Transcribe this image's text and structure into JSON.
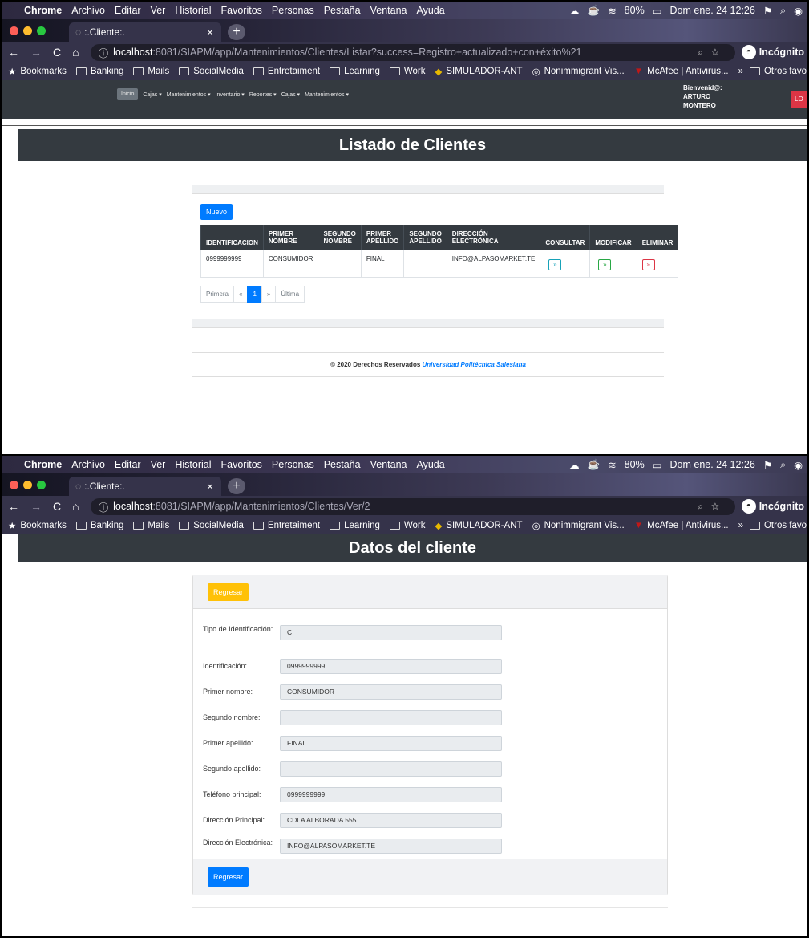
{
  "mac_menu": {
    "app": "Chrome",
    "items": [
      "Archivo",
      "Editar",
      "Ver",
      "Historial",
      "Favoritos",
      "Personas",
      "Pestaña",
      "Ventana",
      "Ayuda"
    ],
    "battery": "80%",
    "datetime": "Dom ene. 24 12:26"
  },
  "browser": {
    "tab_title": ":.Cliente:.",
    "incognito_label": "Incógnito",
    "bookmarks": [
      "Bookmarks",
      "Banking",
      "Mails",
      "SocialMedia",
      "Entretaiment",
      "Learning",
      "Work",
      "SIMULADOR-ANT",
      "Nonimmigrant Vis...",
      "McAfee | Antivirus..."
    ],
    "bookmarks_more": "»",
    "other_favs": "Otros favo"
  },
  "screen1": {
    "url_host": "localhost",
    "url_path": ":8081/SIAPM/app/Mantenimientos/Clientes/Listar?success=Registro+actualizado+con+éxito%21",
    "nav_menu": {
      "home": "Inicio",
      "items": [
        "Cajas",
        "Mantenimientos",
        "Inventario",
        "Reportes",
        "Cajas",
        "Mantenimientos"
      ]
    },
    "welcome": {
      "line1": "Bienvenid@:",
      "line2": "ARTURO",
      "line3": "MONTERO"
    },
    "logout_label": "LO",
    "page_title": "Listado de Clientes",
    "new_button": "Nuevo",
    "table": {
      "headers": [
        "IDENTIFICACION",
        "PRIMER NOMBRE",
        "SEGUNDO NOMBRE",
        "PRIMER APELLIDO",
        "SEGUNDO APELLIDO",
        "DIRECCIÓN ELECTRÓNICA",
        "CONSULTAR",
        "MODIFICAR",
        "ELIMINAR"
      ],
      "rows": [
        {
          "identificacion": "0999999999",
          "primer_nombre": "CONSUMIDOR",
          "segundo_nombre": "",
          "primer_apellido": "FINAL",
          "segundo_apellido": "",
          "email": "INFO@ALPASOMARKET.TE"
        }
      ],
      "action_glyph": "»"
    },
    "pagination": {
      "first": "Primera",
      "prev": "«",
      "current": "1",
      "next": "»",
      "last": "Última"
    },
    "footer": {
      "text": "© 2020 Derechos Reservados",
      "university": "Universidad Poiltécnica Salesiana"
    }
  },
  "screen2": {
    "url_host": "localhost",
    "url_path": ":8081/SIAPM/app/Mantenimientos/Clientes/Ver/2",
    "page_title": "Datos del cliente",
    "back_button_top": "Regresar",
    "back_button_bottom": "Regresar",
    "fields": [
      {
        "label": "Tipo de Identificación:",
        "value": "C"
      },
      {
        "label": "Identificación:",
        "value": "0999999999"
      },
      {
        "label": "Primer nombre:",
        "value": "CONSUMIDOR"
      },
      {
        "label": "Segundo nombre:",
        "value": ""
      },
      {
        "label": "Primer apellido:",
        "value": "FINAL"
      },
      {
        "label": "Segundo apellido:",
        "value": ""
      },
      {
        "label": "Teléfono principal:",
        "value": "0999999999"
      },
      {
        "label": "Dirección Principal:",
        "value": "CDLA ALBORADA 555"
      },
      {
        "label": "Dirección Electrónica:",
        "value": "INFO@ALPASOMARKET.TE"
      }
    ]
  }
}
